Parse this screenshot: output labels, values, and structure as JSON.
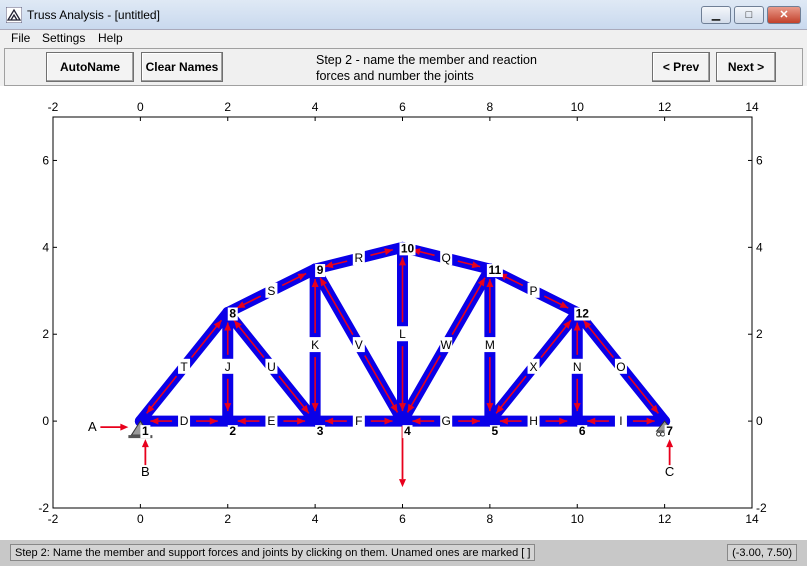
{
  "window": {
    "title": "Truss Analysis - [untitled]",
    "minimize_glyph": "▁",
    "maximize_glyph": "□",
    "close_glyph": "✕"
  },
  "menu": {
    "file": "File",
    "settings": "Settings",
    "help": "Help"
  },
  "toolbar": {
    "autoname_label": "AutoName",
    "clear_names_label": "Clear Names",
    "step_line1": "Step 2 - name the member and reaction",
    "step_line2": "forces and number the joints",
    "prev_label": "< Prev",
    "next_label": "Next >"
  },
  "status": {
    "message": "Step 2: Name the member and support forces and joints by clicking on them.  Unamed ones are marked [ ]",
    "coords": "(-3.00, 7.50)"
  },
  "colors": {
    "member": "#0a00e8",
    "force_arrow": "#e8001c",
    "background": "#ffffff"
  },
  "plot": {
    "x_range": [
      -2,
      14
    ],
    "y_range": [
      -2,
      7
    ],
    "x_ticks": [
      "-2",
      "0",
      "2",
      "4",
      "6",
      "8",
      "10",
      "12",
      "14"
    ],
    "y_ticks": [
      "-2",
      "0",
      "2",
      "4",
      "6"
    ]
  },
  "truss": {
    "joints": [
      {
        "id": "1",
        "x": 0,
        "y": 0
      },
      {
        "id": "2",
        "x": 2,
        "y": 0
      },
      {
        "id": "3",
        "x": 4,
        "y": 0
      },
      {
        "id": "4",
        "x": 6,
        "y": 0
      },
      {
        "id": "5",
        "x": 8,
        "y": 0
      },
      {
        "id": "6",
        "x": 10,
        "y": 0
      },
      {
        "id": "7",
        "x": 12,
        "y": 0
      },
      {
        "id": "8",
        "x": 2,
        "y": 2.5
      },
      {
        "id": "9",
        "x": 4,
        "y": 3.5
      },
      {
        "id": "10",
        "x": 6,
        "y": 4
      },
      {
        "id": "11",
        "x": 8,
        "y": 3.5
      },
      {
        "id": "12",
        "x": 10,
        "y": 2.5
      }
    ],
    "members": [
      {
        "name": "D",
        "a": "1",
        "b": "2"
      },
      {
        "name": "E",
        "a": "2",
        "b": "3"
      },
      {
        "name": "F",
        "a": "3",
        "b": "4"
      },
      {
        "name": "G",
        "a": "4",
        "b": "5"
      },
      {
        "name": "H",
        "a": "5",
        "b": "6"
      },
      {
        "name": "I",
        "a": "6",
        "b": "7"
      },
      {
        "name": "T",
        "a": "1",
        "b": "8"
      },
      {
        "name": "S",
        "a": "8",
        "b": "9"
      },
      {
        "name": "R",
        "a": "9",
        "b": "10"
      },
      {
        "name": "Q",
        "a": "10",
        "b": "11"
      },
      {
        "name": "P",
        "a": "11",
        "b": "12"
      },
      {
        "name": "O",
        "a": "12",
        "b": "7"
      },
      {
        "name": "J",
        "a": "2",
        "b": "8"
      },
      {
        "name": "U",
        "a": "8",
        "b": "3"
      },
      {
        "name": "K",
        "a": "3",
        "b": "9"
      },
      {
        "name": "V",
        "a": "9",
        "b": "4"
      },
      {
        "name": "L",
        "a": "4",
        "b": "10"
      },
      {
        "name": "W",
        "a": "4",
        "b": "11"
      },
      {
        "name": "M",
        "a": "5",
        "b": "11"
      },
      {
        "name": "X",
        "a": "5",
        "b": "12"
      },
      {
        "name": "N",
        "a": "6",
        "b": "12"
      }
    ],
    "reactions": [
      {
        "name": "A",
        "joint": "1",
        "direction": "horizontal"
      },
      {
        "name": "B",
        "joint": "1",
        "direction": "vertical"
      },
      {
        "name": "C",
        "joint": "7",
        "direction": "vertical"
      }
    ],
    "loads": [
      {
        "joint": "4",
        "direction": "down"
      }
    ]
  }
}
